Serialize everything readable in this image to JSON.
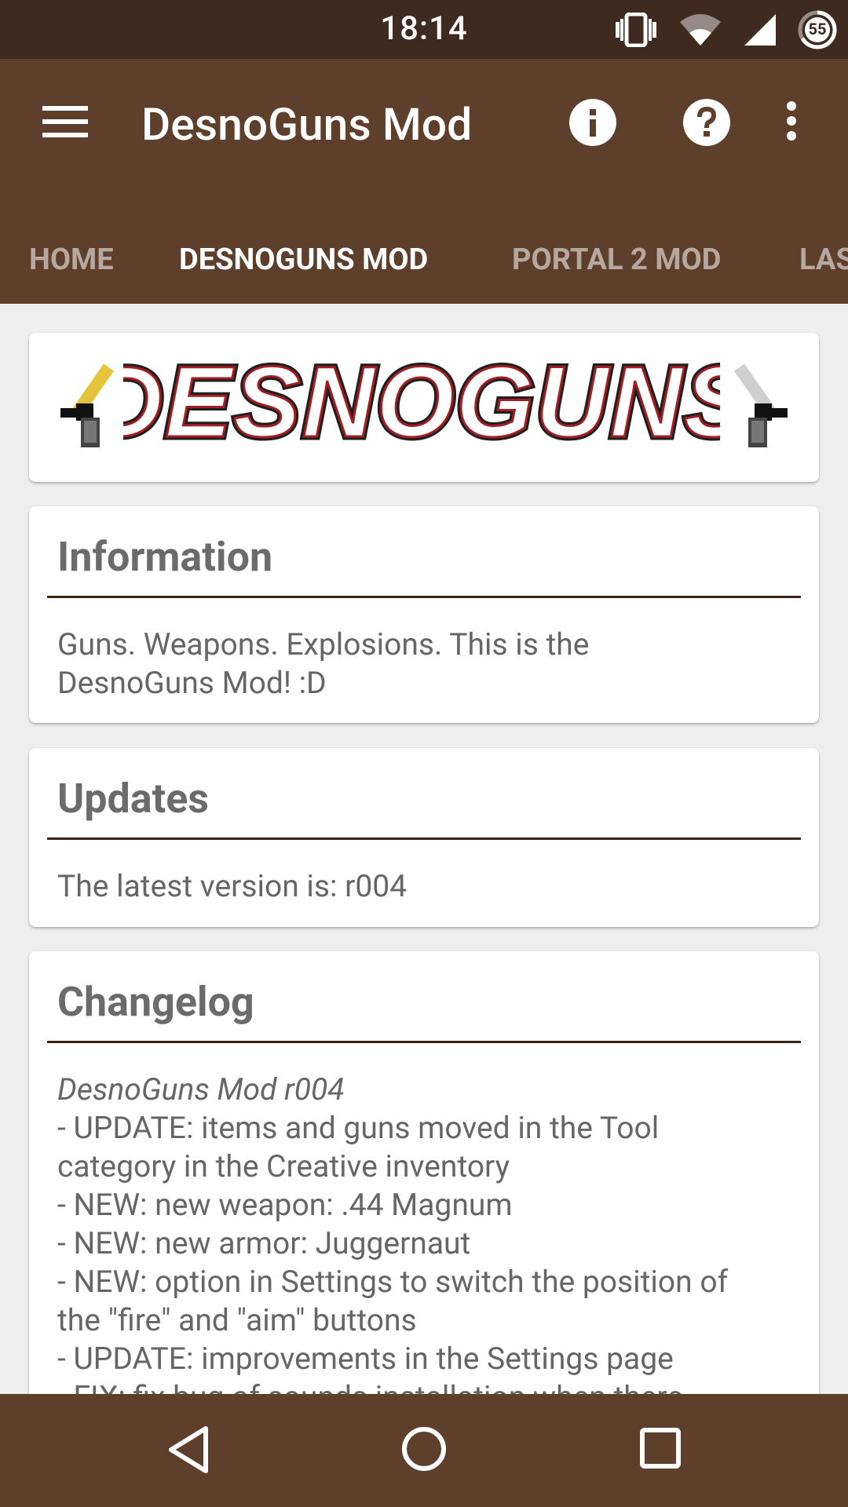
{
  "status_bar": {
    "time": "18:14",
    "battery_level": "55",
    "icons": [
      "vibrate-icon",
      "wifi-icon",
      "cell-signal-icon",
      "battery-icon"
    ]
  },
  "app_bar": {
    "title": "DesnoGuns Mod",
    "icons": [
      "menu-icon",
      "info-icon",
      "help-icon",
      "more-vert-icon"
    ]
  },
  "tabs": [
    {
      "label": "HOME",
      "active": false
    },
    {
      "label": "DESNOGUNS MOD",
      "active": true
    },
    {
      "label": "PORTAL 2 MOD",
      "active": false
    },
    {
      "label": "LAS",
      "active": false
    }
  ],
  "banner": {
    "logo_text": "DESNOGUNS"
  },
  "cards": {
    "information": {
      "title": "Information",
      "body": [
        "Guns. Weapons. Explosions. This is the",
        "DesnoGuns Mod! :D"
      ]
    },
    "updates": {
      "title": "Updates",
      "body": "The latest version is: r004"
    },
    "changelog": {
      "title": "Changelog",
      "version_heading": "DesnoGuns Mod r004",
      "lines": [
        "- UPDATE: items and guns moved in the Tool",
        "category in the Creative inventory",
        "- NEW: new weapon: .44 Magnum",
        "- NEW: new armor: Juggernaut",
        "- NEW: option in Settings to switch the position of",
        "the \"fire\" and \"aim\" buttons",
        "- UPDATE: improvements in the Settings page",
        "- FIX: fix bug of sounds installation when there"
      ]
    }
  },
  "colors": {
    "status_bar": "#3e2a1f",
    "primary": "#5d3f2c",
    "background": "#eeeeee",
    "card": "#ffffff",
    "divider": "#3a241a"
  },
  "nav_bar": {
    "icons": [
      "back-icon",
      "home-icon",
      "recents-icon"
    ]
  }
}
